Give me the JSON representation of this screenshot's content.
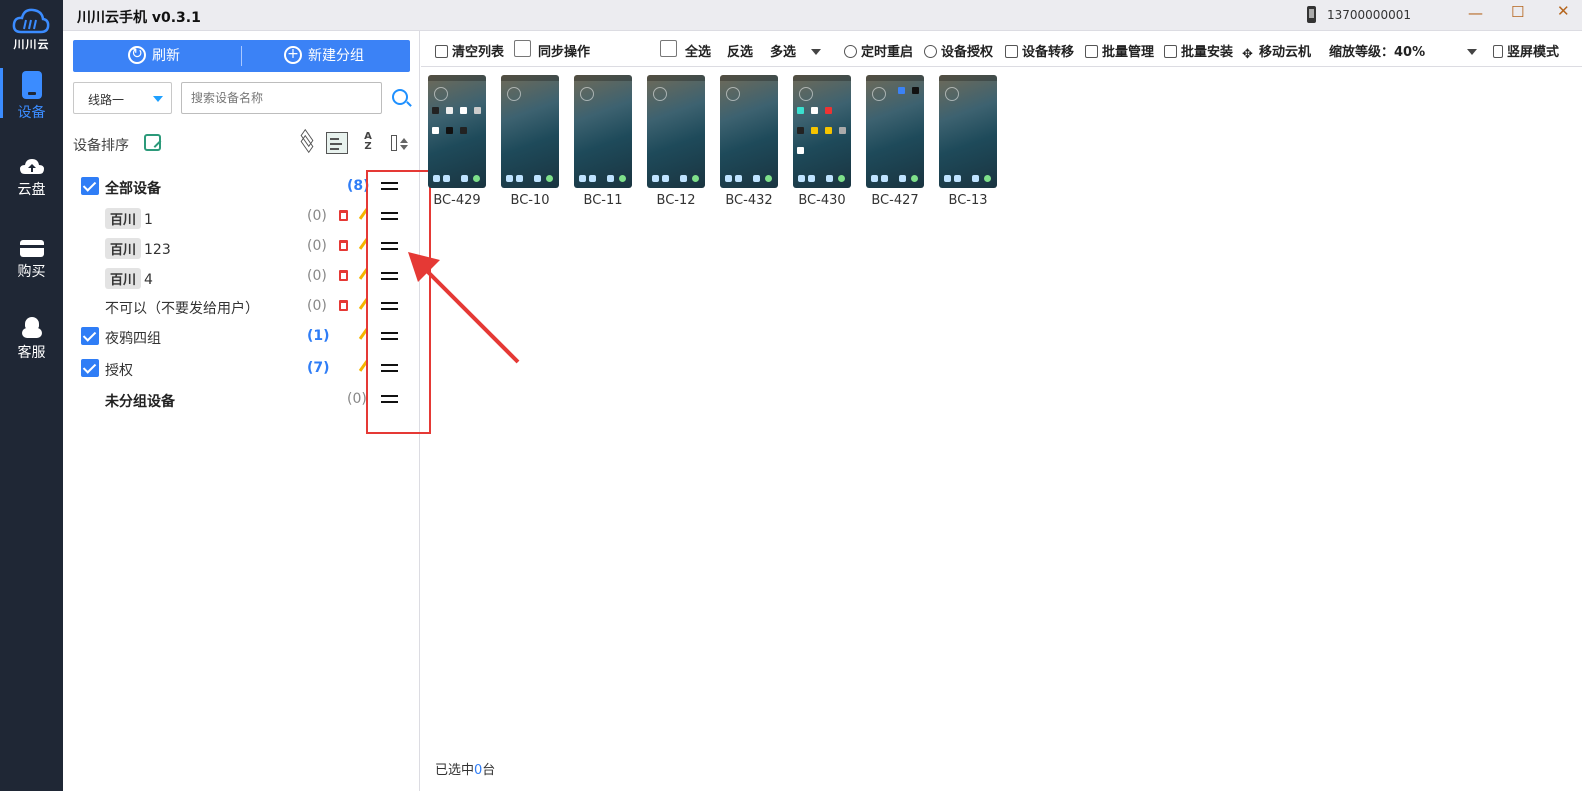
{
  "app": {
    "title": "川川云手机 v0.3.1",
    "logo_text": "川川云",
    "user_id": "13700000001"
  },
  "nav": [
    {
      "label": "设备",
      "icon": "phone-icon",
      "active": true
    },
    {
      "label": "云盘",
      "icon": "cloud-upload-icon",
      "active": false
    },
    {
      "label": "购买",
      "icon": "card-icon",
      "active": false
    },
    {
      "label": "客服",
      "icon": "headset-icon",
      "active": false
    }
  ],
  "left": {
    "refresh_label": "刷新",
    "new_group_label": "新建分组",
    "line_select": "线路一",
    "search_placeholder": "搜索设备名称",
    "sort_label": "设备排序"
  },
  "groups": [
    {
      "name": "全部设备",
      "count": "(8)",
      "checked": true,
      "bold": true,
      "count_blue": true
    },
    {
      "tag": "百川",
      "name": "1",
      "count": "(0)"
    },
    {
      "tag": "百川",
      "name": "123",
      "count": "(0)"
    },
    {
      "tag": "百川",
      "name": "4",
      "count": "(0)"
    },
    {
      "name": "不可以（不要发给用户）",
      "count": "(0)"
    },
    {
      "name": "夜鸦四组",
      "count": "(1)",
      "checked": true,
      "count_blue": true
    },
    {
      "name": "授权",
      "count": "(7)",
      "checked": true,
      "count_blue": true
    },
    {
      "name": "未分组设备",
      "count": "(0)",
      "bold": true
    }
  ],
  "toolbar": {
    "clear_list": "清空列表",
    "sync_op": "同步操作",
    "select_all": "全选",
    "invert": "反选",
    "multi": "多选",
    "timed_restart": "定时重启",
    "device_auth": "设备授权",
    "device_transfer": "设备转移",
    "batch_manage": "批量管理",
    "batch_install": "批量安装",
    "move_cloud": "移动云机",
    "zoom": "缩放等级：40%",
    "portrait": "竖屏模式"
  },
  "devices": [
    "BC-429",
    "BC-10",
    "BC-11",
    "BC-12",
    "BC-432",
    "BC-430",
    "BC-427",
    "BC-13"
  ],
  "status": {
    "prefix": "已选中",
    "count": "0",
    "suffix": "台"
  },
  "colors": {
    "accent": "#2f7df6",
    "nav_bg": "#1f2735",
    "highlight": "#e53935"
  }
}
